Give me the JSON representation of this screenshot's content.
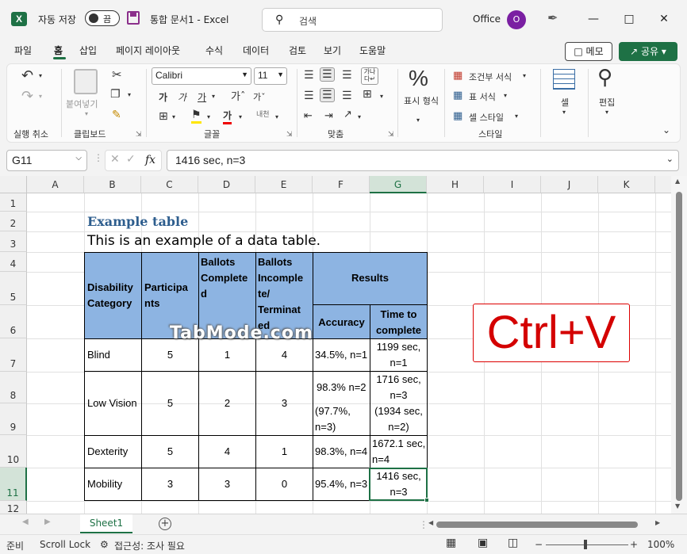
{
  "titlebar": {
    "autosave_label": "자동 저장",
    "autosave_state": "끔",
    "doc_title": "통합 문서1  -  Excel",
    "search_placeholder": "검색",
    "office_label": "Office",
    "avatar_initial": "O"
  },
  "menu": {
    "tabs": [
      "파일",
      "홈",
      "삽입",
      "페이지 레이아웃",
      "수식",
      "데이터",
      "검토",
      "보기",
      "도움말"
    ],
    "memo_label": "메모",
    "share_label": "공유"
  },
  "ribbon": {
    "paste_label": "붙여넣기",
    "font_name": "Calibri",
    "font_size": "11",
    "number_label": "표시 형식",
    "cond_format": "조건부 서식",
    "table_format": "표 서식",
    "cell_style": "셀 스타일",
    "cells_label": "셀",
    "edit_label": "편집",
    "groups": [
      "실행 취소",
      "클립보드",
      "글꼴",
      "맞춤",
      "스타일"
    ]
  },
  "formula_bar": {
    "name_box": "G11",
    "fx": "fx",
    "formula": "1416 sec, n=3"
  },
  "grid": {
    "columns": [
      "A",
      "B",
      "C",
      "D",
      "E",
      "F",
      "G",
      "H",
      "I",
      "J",
      "K"
    ],
    "rows": [
      "1",
      "2",
      "3",
      "4",
      "5",
      "6",
      "7",
      "8",
      "9",
      "10",
      "11",
      "12"
    ],
    "selected_column": "G",
    "selected_row": "11"
  },
  "sheet": {
    "title": "Example table",
    "subtitle": "This is an example of a data table.",
    "headers": {
      "disability": "Disability Category",
      "participants": "Participa nts",
      "completed": "Ballots Complete d",
      "incomplete": "Ballots Incomple te/ Terminat ed",
      "results": "Results",
      "accuracy": "Accuracy",
      "time": "Time to complete"
    },
    "rows": [
      {
        "category": "Blind",
        "participants": "5",
        "completed": "1",
        "incomplete": "4",
        "accuracy": "34.5%, n=1",
        "time": "1199 sec, n=1"
      },
      {
        "category": "Low Vision",
        "participants": "5",
        "completed": "2",
        "incomplete": "3",
        "accuracy": "98.3% n=2",
        "accuracy2": "(97.7%, n=3)",
        "time": "1716 sec, n=3",
        "time2": "(1934 sec, n=2)"
      },
      {
        "category": "Dexterity",
        "participants": "5",
        "completed": "4",
        "incomplete": "1",
        "accuracy": "98.3%, n=4",
        "time": "1672.1 sec, n=4"
      },
      {
        "category": "Mobility",
        "participants": "3",
        "completed": "3",
        "incomplete": "0",
        "accuracy": "95.4%, n=3",
        "time": "1416 sec, n=3"
      }
    ],
    "overlay_text": "Ctrl+V",
    "watermark": "TabMode.com"
  },
  "sheet_tabs": [
    "Sheet1"
  ],
  "status": {
    "ready": "준비",
    "scroll_lock": "Scroll Lock",
    "accessibility": "접근성: 조사 필요",
    "zoom": "100%"
  },
  "colors": {
    "excel_green": "#1e7145",
    "header_fill": "#8db4e2",
    "overlay_red": "#d40000"
  }
}
